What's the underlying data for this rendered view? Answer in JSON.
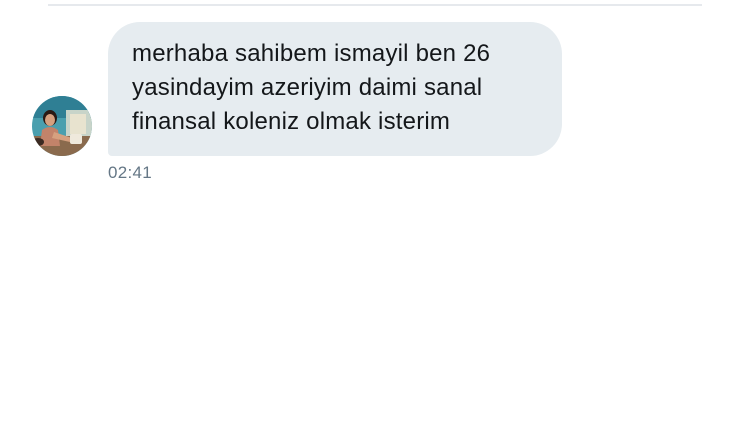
{
  "conversation": {
    "messages": [
      {
        "text": "merhaba sahibem ismayil ben 26\nyasindayim azeriyim daimi sanal\nfinansal koleniz olmak isterim",
        "time": "02:41",
        "avatar_icon": "user-avatar-photo"
      }
    ]
  },
  "colors": {
    "bubble_background": "#e6ecf0",
    "text": "#14171a",
    "timestamp": "#657786",
    "divider": "#e6e9ed"
  }
}
